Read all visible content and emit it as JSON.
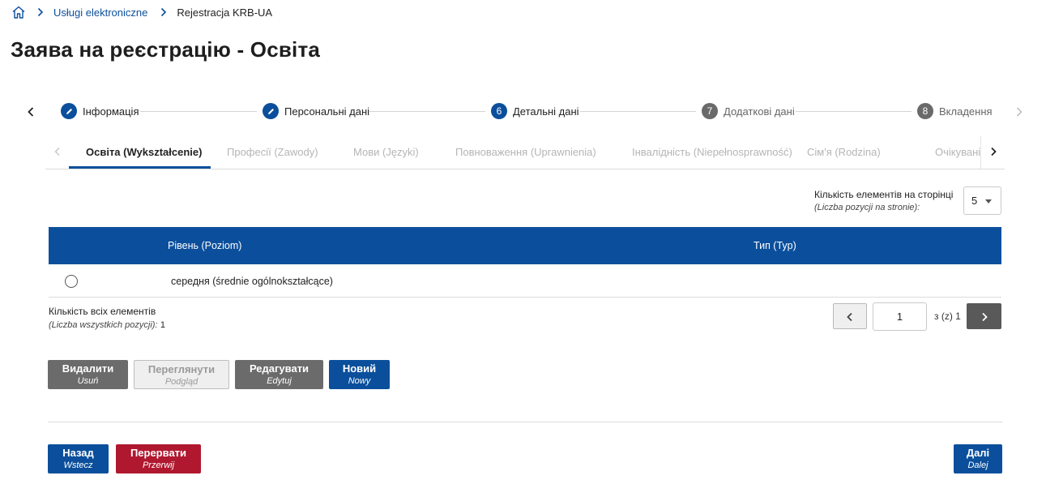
{
  "breadcrumb": {
    "home_icon": "home-icon",
    "items": [
      "Usługi elektroniczne",
      "Rejestracja KRB-UA"
    ]
  },
  "page_title": "Заява на реєстрацію - Освіта",
  "stepper": {
    "steps": [
      {
        "marker": "pencil-icon",
        "label": "Інформація",
        "state": "completed"
      },
      {
        "marker": "pencil-icon",
        "label": "Персональні дані",
        "state": "completed"
      },
      {
        "marker": "6",
        "label": "Детальні дані",
        "state": "current"
      },
      {
        "marker": "7",
        "label": "Додаткові дані",
        "state": "pending"
      },
      {
        "marker": "8",
        "label": "Вкладення",
        "state": "pending"
      }
    ]
  },
  "tabs": {
    "items": [
      {
        "label": "Освіта (Wykształcenie)",
        "active": true
      },
      {
        "label": "Професії (Zawody)",
        "active": false
      },
      {
        "label": "Мови (Języki)",
        "active": false
      },
      {
        "label": "Повноваження (Uprawnienia)",
        "active": false
      },
      {
        "label": "Інвалідність (Niepełnosprawność)",
        "active": false
      },
      {
        "label": "Сім'я (Rodzina)",
        "active": false
      },
      {
        "label": "Очікувані",
        "active": false
      }
    ]
  },
  "per_page": {
    "label": "Кількість елементів на сторінці",
    "label_pl": "(Liczba pozycji na stronie):",
    "value": "5"
  },
  "table": {
    "columns": [
      "Рівень (Poziom)",
      "Тип (Typ)"
    ],
    "rows": [
      {
        "level": "середня (średnie ogólnokształcące)",
        "type": ""
      }
    ]
  },
  "totals": {
    "label": "Кількість всіх елементів",
    "label_pl": "(Liczba wszystkich pozycji):",
    "count": "1"
  },
  "pagination": {
    "current": "1",
    "of_text": "з (z) 1"
  },
  "actions": {
    "delete": {
      "label": "Видалити",
      "sub": "Usuń"
    },
    "view": {
      "label": "Переглянути",
      "sub": "Podgląd"
    },
    "edit": {
      "label": "Редагувати",
      "sub": "Edytuj"
    },
    "new": {
      "label": "Новий",
      "sub": "Nowy"
    }
  },
  "nav": {
    "back": {
      "label": "Назад",
      "sub": "Wstecz"
    },
    "abort": {
      "label": "Перервати",
      "sub": "Przerwij"
    },
    "next": {
      "label": "Далі",
      "sub": "Dalej"
    }
  },
  "colors": {
    "primary": "#0b4f9c",
    "danger": "#b0182f",
    "neutral": "#6b6b6b"
  }
}
